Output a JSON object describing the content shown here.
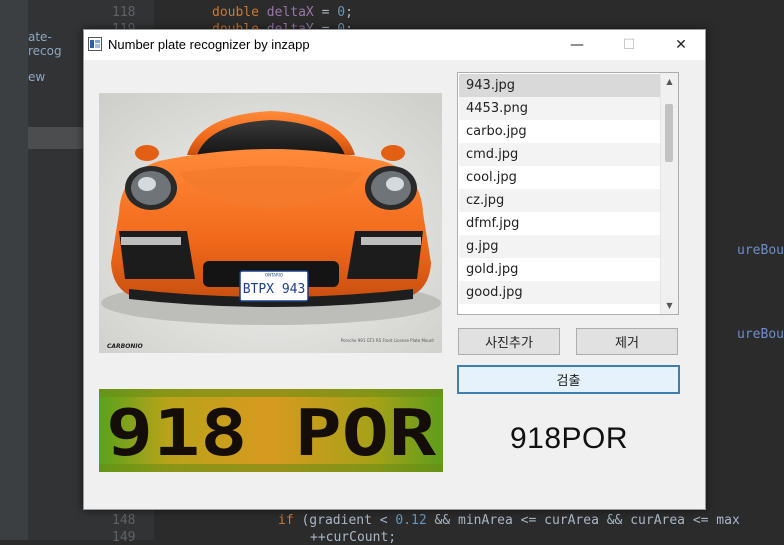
{
  "ide": {
    "tree_items": [
      "ate-recog",
      "ew"
    ],
    "lines": [
      {
        "no": "118",
        "kw": "double",
        "name": "deltaX",
        "rest": " = ",
        "num": "0",
        "end": ";"
      },
      {
        "no": "119",
        "kw": "double",
        "name": "deltaY",
        "rest": " = ",
        "num": "0",
        "end": ";"
      }
    ],
    "bottom_lines": [
      {
        "no": "148",
        "text_kw": "if",
        "text_a": " (gradient < ",
        "text_num": "0.12",
        "text_b": " && minArea <= curArea && curArea <= max"
      },
      {
        "no": "149",
        "text": "++curCount;"
      }
    ],
    "right_fragments": [
      "ureBou",
      "ureBou"
    ]
  },
  "window": {
    "title": "Number plate recognizer by inzapp",
    "minimize": "—",
    "maximize": "☐",
    "close": "✕"
  },
  "file_list": {
    "items": [
      "943.jpg",
      "4453.png",
      "carbo.jpg",
      "cmd.jpg",
      "cool.jpg",
      "cz.jpg",
      "dfmf.jpg",
      "g.jpg",
      "gold.jpg",
      "good.jpg"
    ],
    "selected_index": 0
  },
  "photo": {
    "plate_text": "BTPX 943",
    "brand": "CARBONIO",
    "caption": "Porsche 991 GT3 RS Front License Plate Mount"
  },
  "plate_crop": {
    "text": "918 POR"
  },
  "buttons": {
    "add_photo": "사진추가",
    "remove": "제거",
    "detect": "검출"
  },
  "result": {
    "text": "918POR"
  },
  "colors": {
    "car_orange": "#f26a1b",
    "plate_bg": "#9a9418",
    "focus_border": "#3c7fb1"
  }
}
